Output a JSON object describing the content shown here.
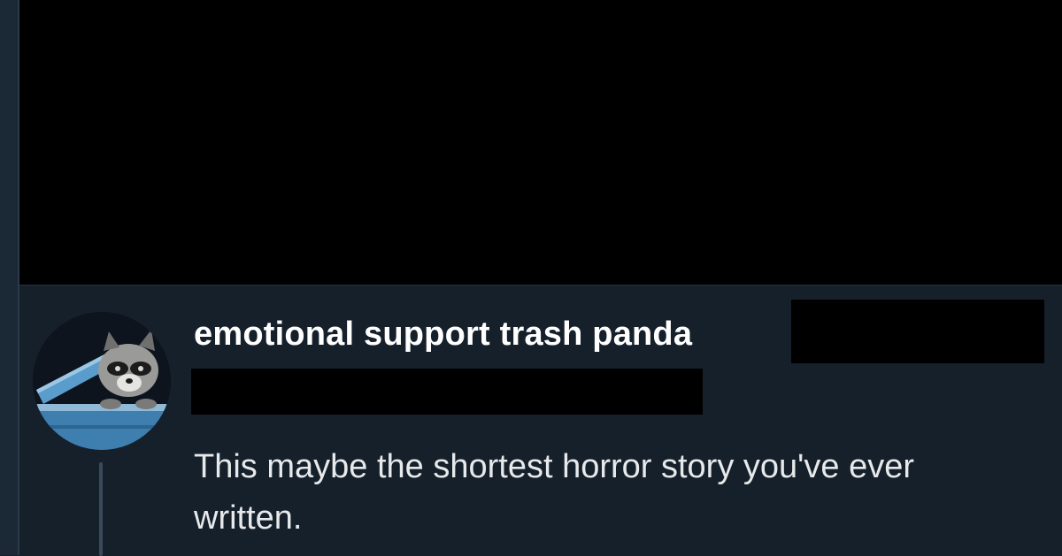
{
  "reply": {
    "display_name": "emotional support trash panda",
    "text": "This maybe the shortest horror story you've ever written."
  },
  "icons": {
    "avatar": "raccoon-avatar-icon"
  },
  "colors": {
    "background": "#15202b",
    "redaction": "#000000",
    "name_text": "#ffffff",
    "body_text": "#e7e9ea"
  }
}
